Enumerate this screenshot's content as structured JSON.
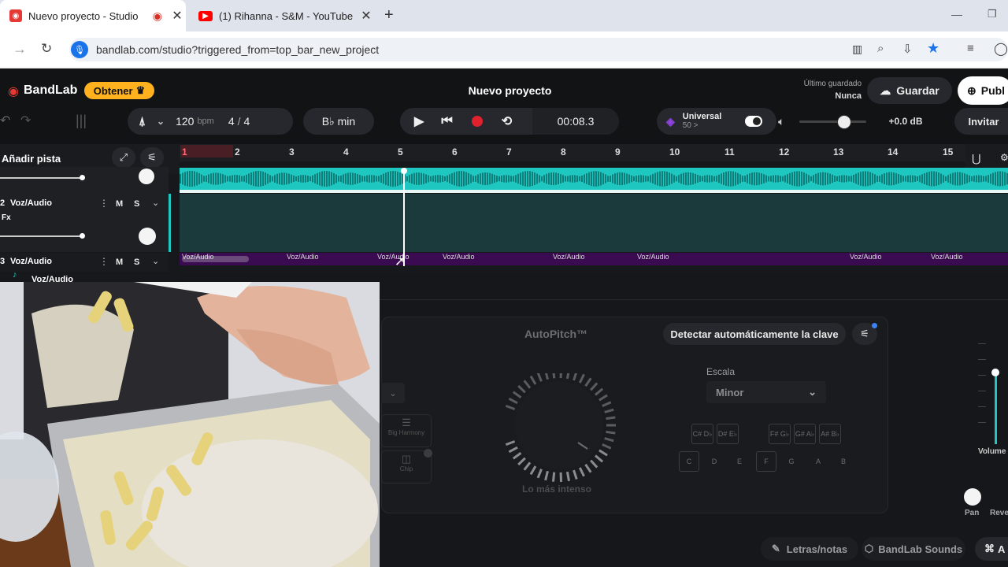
{
  "browser": {
    "tabs": [
      {
        "title": "Nuevo proyecto - Studio",
        "icon": "bandlab-icon"
      },
      {
        "title": "(1) Rihanna - S&M - YouTube",
        "icon": "youtube-icon"
      }
    ],
    "url": "bandlab.com/studio?triggered_from=top_bar_new_project"
  },
  "app": {
    "brand": "BandLab",
    "obtener": "Obtener",
    "project_title": "Nuevo proyecto",
    "last_saved_label": "Último guardado",
    "last_saved_value": "Nunca",
    "save": "Guardar",
    "publish": "Publ",
    "tempo": "120",
    "tempo_unit": "bpm",
    "time_sig_num": "4",
    "time_sig_sep": "/",
    "time_sig_den": "4",
    "key": "B♭ min",
    "time": "00:08.3",
    "instrument": "Universal",
    "instrument_sub": "50 >",
    "gain": "+0.0 dB",
    "invite": "Invitar",
    "add_track": "Añadir pista",
    "ruler": [
      "1",
      "2",
      "3",
      "4",
      "5",
      "6",
      "7",
      "8",
      "9",
      "10",
      "11",
      "12",
      "13",
      "14",
      "15"
    ]
  },
  "tracks": [
    {
      "num": "2",
      "name": "Voz/Audio",
      "fx": "Fx",
      "mute": "M",
      "solo": "S"
    },
    {
      "num": "3",
      "name": "Voz/Audio",
      "mute": "M",
      "solo": "S"
    },
    {
      "name": "Voz/Audio"
    }
  ],
  "region_labels": [
    "Voz/Audio",
    "Voz/Audio",
    "Voz/Audio",
    "Voz/Audio",
    "Voz/Audio",
    "Voz/Audio",
    "Voz/Audio",
    "Voz/Audio"
  ],
  "autopitch": {
    "title": "AutoPitch™",
    "detect": "Detectar automáticamente la clave",
    "scale_label": "Escala",
    "scale_value": "Minor",
    "intensity": "Lo más intenso",
    "effects": [
      "Big Harmony",
      "Chip"
    ],
    "sharps": [
      "C# D♭",
      "D# E♭",
      "F# G♭",
      "G# A♭",
      "A# B♭"
    ],
    "naturals": [
      "C",
      "D",
      "E",
      "F",
      "G",
      "A",
      "B"
    ],
    "volume": "Volume",
    "pan": "Pan",
    "reverb": "Reve"
  },
  "footer": {
    "lyrics": "Letras/notas",
    "sounds": "BandLab Sounds",
    "shortcut": "A"
  },
  "colors": {
    "accent": "#1fc7c1",
    "region": "#3b0b52",
    "record": "#e0222f",
    "obtener": "#ffb21e"
  }
}
